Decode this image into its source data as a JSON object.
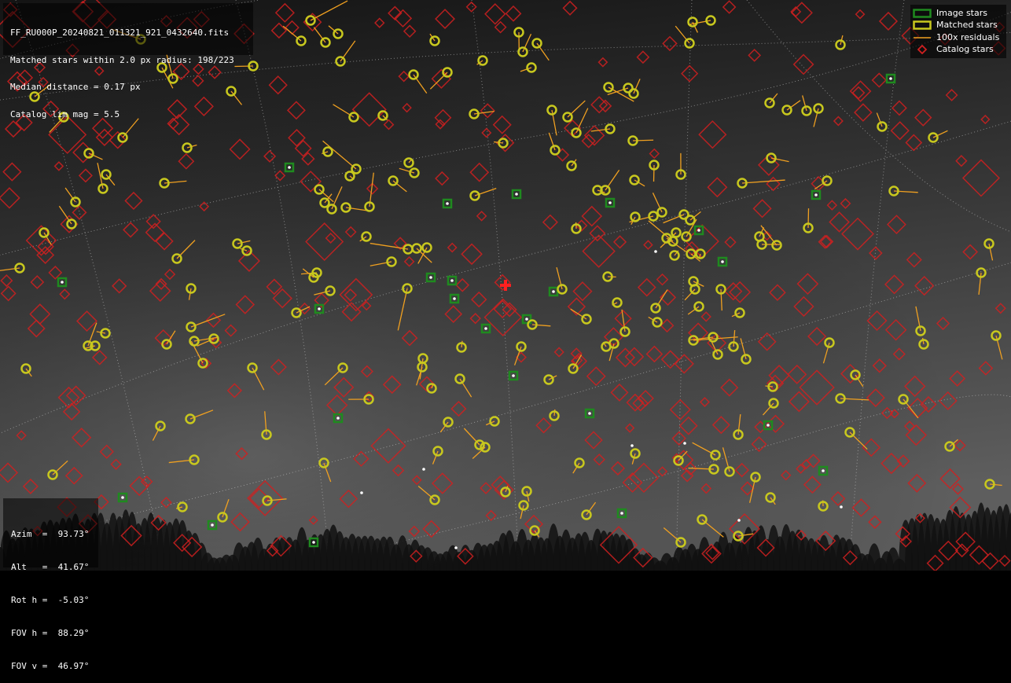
{
  "info": {
    "filename": "FF_RU000P_20240821_011321_921_0432640.fits",
    "matched_line": "Matched stars within 2.0 px radius: 198/223",
    "median_line": "Median distance = 0.17 px",
    "limmag_line": "Catalog lim mag = 5.5"
  },
  "pointing": {
    "azim": "Azim  =  93.73°",
    "alt": "Alt   =  41.67°",
    "rot": "Rot h =  -5.03°",
    "fov_h": "FOV h =  88.29°",
    "fov_v": "FOV v =  46.97°"
  },
  "legend": {
    "image_stars": "Image stars",
    "matched_stars": "Matched stars",
    "residuals": "100x residuals",
    "catalog_stars": "Catalog stars"
  },
  "colors": {
    "image_star": "#1f8a1f",
    "matched_star": "#c8c81e",
    "residual": "#f0a020",
    "catalog_star": "#d02020",
    "center_cross": "#ff2020",
    "grid": "#cfcfcf"
  }
}
